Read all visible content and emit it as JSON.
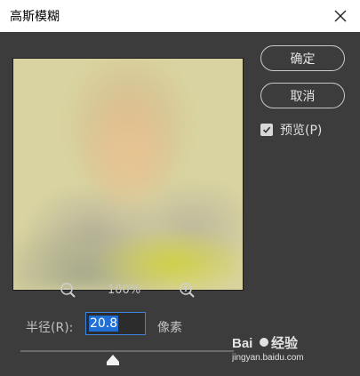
{
  "dialog": {
    "title": "高斯模糊",
    "close_icon": "close-icon"
  },
  "buttons": {
    "ok": "确定",
    "cancel": "取消"
  },
  "preview_option": {
    "label": "预览(P)",
    "checked": true
  },
  "zoom": {
    "level": "100%",
    "zoom_out_icon": "zoom-out-icon",
    "zoom_in_icon": "zoom-in-icon"
  },
  "radius": {
    "label": "半径(R):",
    "value": "20.8",
    "unit": "像素"
  },
  "colors": {
    "panel": "#3c3c3c",
    "accent": "#1f6fd6"
  }
}
